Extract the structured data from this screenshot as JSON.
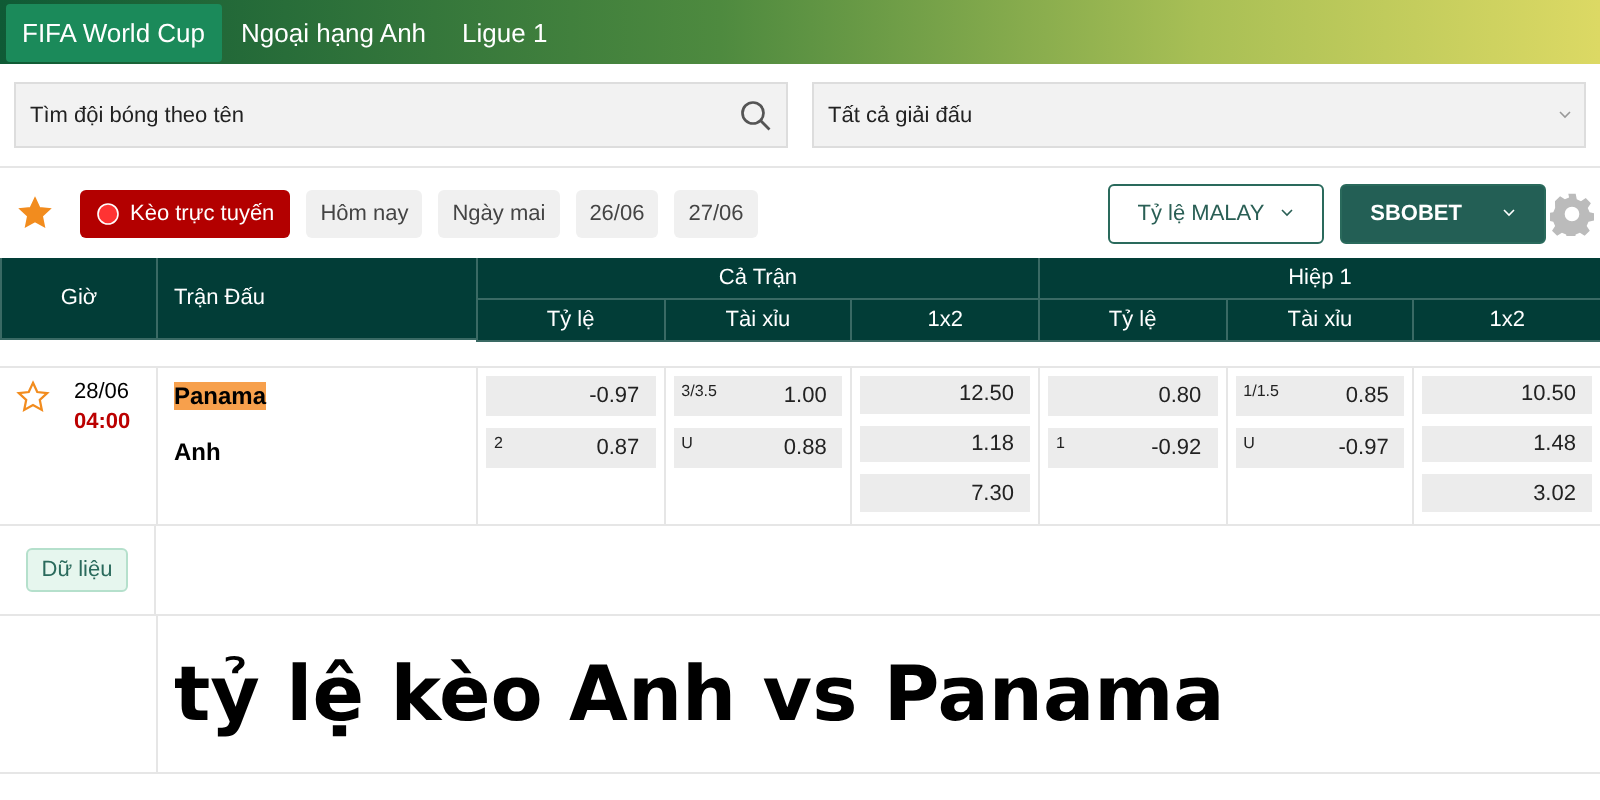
{
  "tabs": [
    {
      "label": "FIFA World Cup",
      "selected": true
    },
    {
      "label": "Ngoại hạng Anh",
      "selected": false
    },
    {
      "label": "Ligue 1",
      "selected": false
    }
  ],
  "search": {
    "placeholder": "Tìm đội bóng theo tên"
  },
  "league_select": {
    "value": "Tất cả giải đấu"
  },
  "toolbar": {
    "favorite": true,
    "live_button": "Kèo trực tuyến",
    "dates": [
      {
        "label": "Hôm nay",
        "selected": false
      },
      {
        "label": "Ngày mai",
        "selected": false
      },
      {
        "label": "26/06",
        "selected": false
      },
      {
        "label": "27/06",
        "selected": false
      }
    ],
    "odds_format": "Tỷ lệ MALAY",
    "bookmaker": "SBOBET"
  },
  "table": {
    "time_header": "Giờ",
    "match_header": "Trận Đấu",
    "groups": [
      {
        "title": "Cả Trận",
        "columns": [
          "Tỷ lệ",
          "Tài xỉu",
          "1x2"
        ]
      },
      {
        "title": "Hiệp 1",
        "columns": [
          "Tỷ lệ",
          "Tài xỉu",
          "1x2"
        ]
      }
    ],
    "match": {
      "favorite": false,
      "date": "28/06",
      "time": "04:00",
      "home": {
        "name": "Panama",
        "highlighted": true
      },
      "away": {
        "name": "Anh",
        "highlighted": false
      },
      "odds": [
        [
          {
            "value": "-0.97"
          },
          {
            "line": "2",
            "value": "0.87"
          }
        ],
        [
          {
            "line": "3/3.5",
            "value": "1.00"
          },
          {
            "line": "U",
            "value": "0.88"
          }
        ],
        [
          {
            "value": "12.50"
          },
          {
            "value": "1.18"
          },
          {
            "value": "7.30"
          }
        ],
        [
          {
            "value": "0.80"
          },
          {
            "line": "1",
            "value": "-0.92"
          }
        ],
        [
          {
            "line": "1/1.5",
            "value": "0.85"
          },
          {
            "line": "U",
            "value": "-0.97"
          }
        ],
        [
          {
            "value": "10.50"
          },
          {
            "value": "1.48"
          },
          {
            "value": "3.02"
          }
        ]
      ]
    }
  },
  "data_button": "Dữ liệu",
  "headline": "tỷ lệ kèo Anh vs Panama"
}
